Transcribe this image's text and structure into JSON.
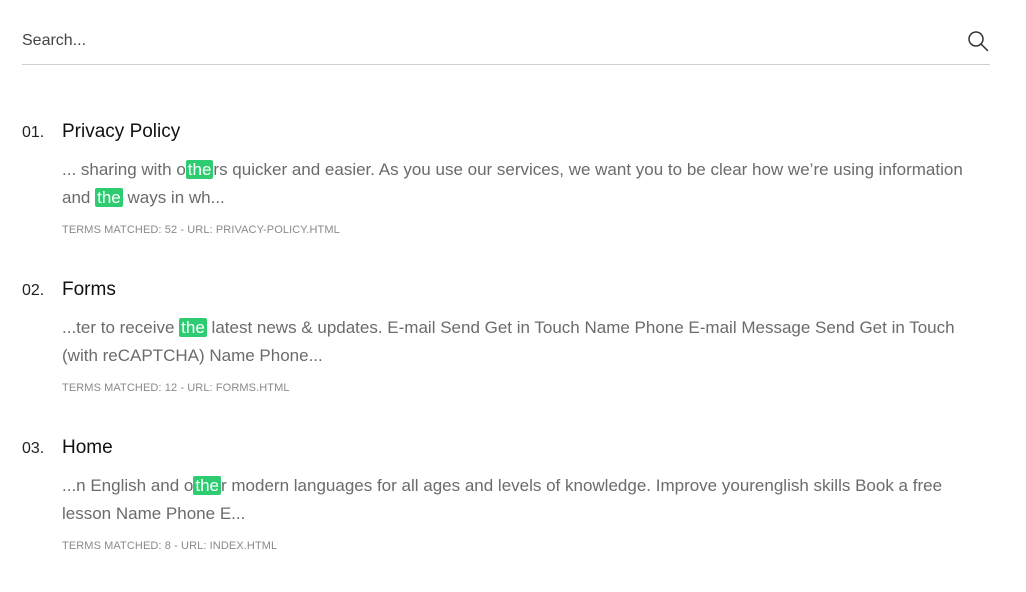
{
  "search": {
    "placeholder": "Search..."
  },
  "results": [
    {
      "number": "01.",
      "title": "Privacy Policy",
      "snippet_line1_a": "... sharing with o",
      "snippet_line1_hl": "the",
      "snippet_line1_b": "rs quicker and easier. As you use our services, we want you to be clear how we’re using",
      "snippet_line2_a": "information and ",
      "snippet_line2_hl": "the",
      "snippet_line2_b": " ways in wh...",
      "meta": "TERMS MATCHED: 52 - URL: PRIVACY-POLICY.HTML"
    },
    {
      "number": "02.",
      "title": "Forms",
      "snippet_a": "...ter to receive ",
      "snippet_hl": "the",
      "snippet_b": " latest news & updates. E-mail Send Get in Touch Name Phone E-mail Message Send Get in Touch (with reCAPTCHA) Name Phone...",
      "meta": "TERMS MATCHED: 12 - URL: FORMS.HTML"
    },
    {
      "number": "03.",
      "title": "Home",
      "snippet_a": "...n English and o",
      "snippet_hl": "the",
      "snippet_b": "r modern languages for all ages and levels of knowledge. Improve yourenglish skills Book a free lesson Name Phone E...",
      "meta": "TERMS MATCHED: 8 - URL: INDEX.HTML"
    }
  ],
  "colors": {
    "highlight": "#2ecc71"
  }
}
